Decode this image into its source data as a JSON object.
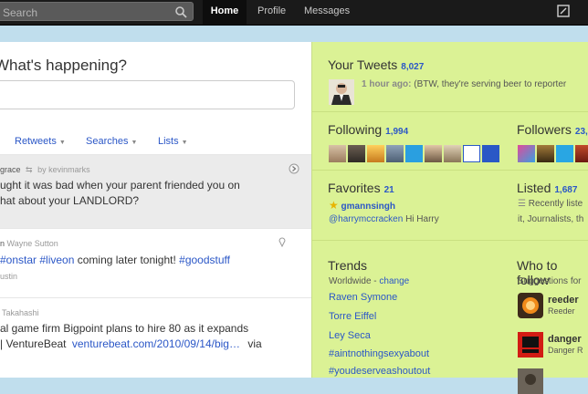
{
  "header": {
    "search_placeholder": "Search",
    "nav": {
      "home": "Home",
      "profile": "Profile",
      "messages": "Messages"
    }
  },
  "main": {
    "prompt": "What's happening?",
    "tabs": {
      "retweets": "Retweets",
      "searches": "Searches",
      "lists": "Lists"
    },
    "tweets": [
      {
        "meta_user": "grace",
        "meta_by": "by kevinmarks",
        "line1": "ught it was bad when your parent friended you on",
        "line2": "hat about your LANDLORD?"
      },
      {
        "meta_user": "Wayne Sutton",
        "line1_a": "#onstar",
        "line1_b": "#liveon",
        "line1_c": "coming later tonight!",
        "line1_d": "#goodstuff",
        "meta_sub": "Austin"
      },
      {
        "meta_user": "Takahashi",
        "line1": "al game firm Bigpoint plans to hire 80 as it expands",
        "line2_a": "| VentureBeat",
        "line2_link": "venturebeat.com/2010/09/14/big…",
        "line2_b": "via"
      }
    ]
  },
  "sidebar": {
    "your_tweets": {
      "label": "Your Tweets",
      "count": "8,027",
      "time": "1 hour ago:",
      "snippet": "(BTW, they're serving beer to reporter"
    },
    "following": {
      "label": "Following",
      "count": "1,994"
    },
    "followers": {
      "label": "Followers",
      "count": "23,"
    },
    "favorites": {
      "label": "Favorites",
      "count": "21",
      "user": "gmannsingh",
      "reply_handle": "@harrymccracken",
      "reply_text": "Hi Harry"
    },
    "listed": {
      "label": "Listed",
      "count": "1,687",
      "line1": "Recently liste",
      "line2": "it, Journalists, th"
    },
    "trends": {
      "label": "Trends",
      "location": "Worldwide",
      "change": "change",
      "items": [
        "Raven Symone",
        "Torre Eiffel",
        "Ley Seca",
        "#aintnothingsexyabout",
        "#youdeserveashoutout"
      ]
    },
    "who_to_follow": {
      "label": "Who to follow",
      "sub": "Suggestions for",
      "items": [
        {
          "name": "reeder",
          "sub": "Reeder"
        },
        {
          "name": "danger",
          "sub": "Danger R"
        },
        {
          "name": ""
        }
      ]
    }
  }
}
